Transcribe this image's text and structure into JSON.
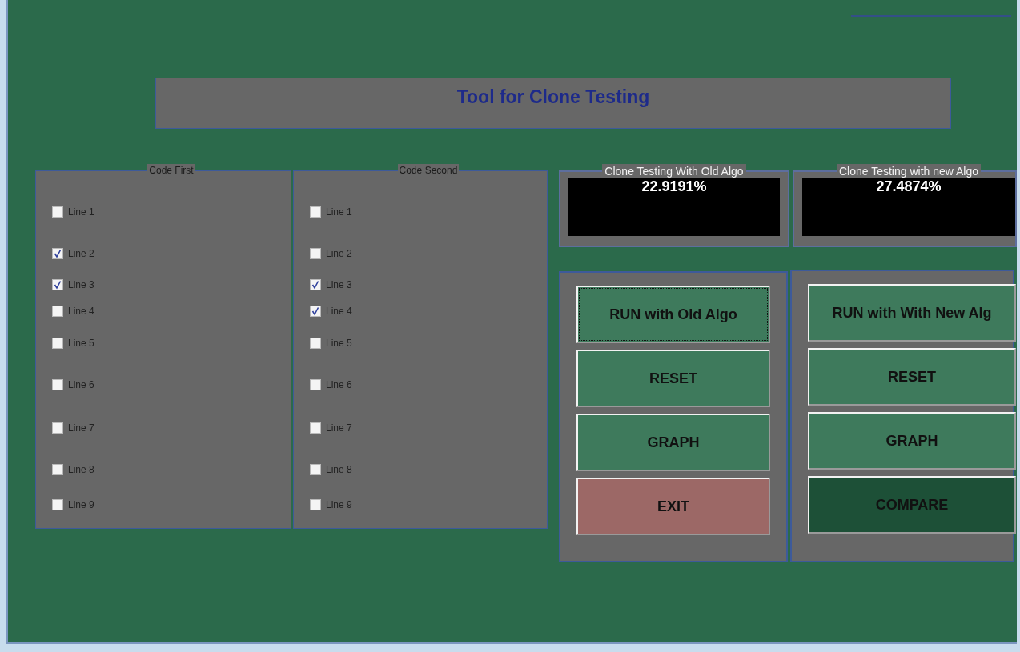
{
  "title": "Tool for Clone Testing",
  "code_panels": [
    {
      "title": "Code First",
      "lines": [
        {
          "label": "Line 1",
          "checked": false
        },
        {
          "label": "Line 2",
          "checked": true
        },
        {
          "label": "Line 3",
          "checked": true
        },
        {
          "label": "Line 4",
          "checked": false
        },
        {
          "label": "Line 5",
          "checked": false
        },
        {
          "label": "Line 6",
          "checked": false
        },
        {
          "label": "Line 7",
          "checked": false
        },
        {
          "label": "Line 8",
          "checked": false
        },
        {
          "label": "Line 9",
          "checked": false
        }
      ]
    },
    {
      "title": "Code Second",
      "lines": [
        {
          "label": "Line 1",
          "checked": false
        },
        {
          "label": "Line 2",
          "checked": false
        },
        {
          "label": "Line 3",
          "checked": true
        },
        {
          "label": "Line 4",
          "checked": true
        },
        {
          "label": "Line 5",
          "checked": false
        },
        {
          "label": "Line 6",
          "checked": false
        },
        {
          "label": "Line 7",
          "checked": false
        },
        {
          "label": "Line 8",
          "checked": false
        },
        {
          "label": "Line 9",
          "checked": false
        }
      ]
    }
  ],
  "results": [
    {
      "title": "Clone Testing With Old Algo",
      "value": "22.9191%"
    },
    {
      "title": "Clone Testing with new Algo",
      "value": "27.4874%"
    }
  ],
  "button_panels": [
    {
      "buttons": [
        {
          "label": "RUN with Old Algo",
          "color": "#3e7a5c",
          "focused": true
        },
        {
          "label": "RESET",
          "color": "#3e7a5c",
          "focused": false
        },
        {
          "label": "GRAPH",
          "color": "#3e7a5c",
          "focused": false
        },
        {
          "label": "EXIT",
          "color": "#9c6866",
          "focused": false
        }
      ]
    },
    {
      "buttons": [
        {
          "label": "RUN with With New Alg",
          "color": "#3e7a5c",
          "focused": false
        },
        {
          "label": "RESET",
          "color": "#3e7a5c",
          "focused": false
        },
        {
          "label": "GRAPH",
          "color": "#3e7a5c",
          "focused": false
        },
        {
          "label": "COMPARE",
          "color": "#1d5037",
          "focused": false
        }
      ]
    }
  ]
}
